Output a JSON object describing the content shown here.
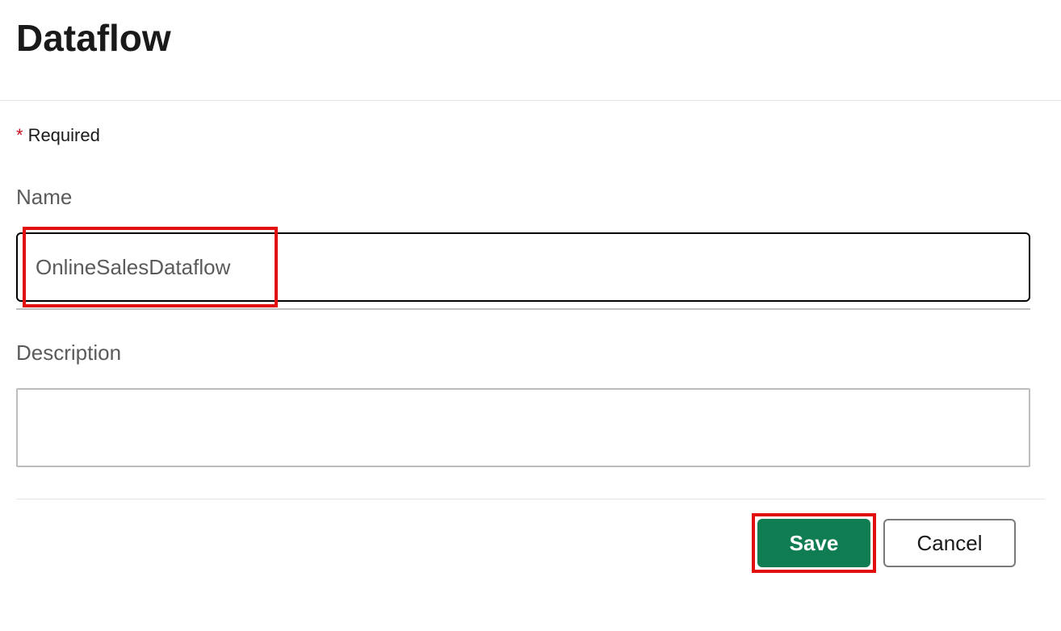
{
  "title": "Dataflow",
  "requiredLabel": "Required",
  "fields": {
    "nameLabel": "Name",
    "nameValue": "OnlineSalesDataflow",
    "descriptionLabel": "Description",
    "descriptionValue": ""
  },
  "buttons": {
    "save": "Save",
    "cancel": "Cancel"
  },
  "colors": {
    "primaryAccent": "#107c52",
    "highlight": "#e20f0f",
    "requiredAsterisk": "#c50f1f"
  }
}
